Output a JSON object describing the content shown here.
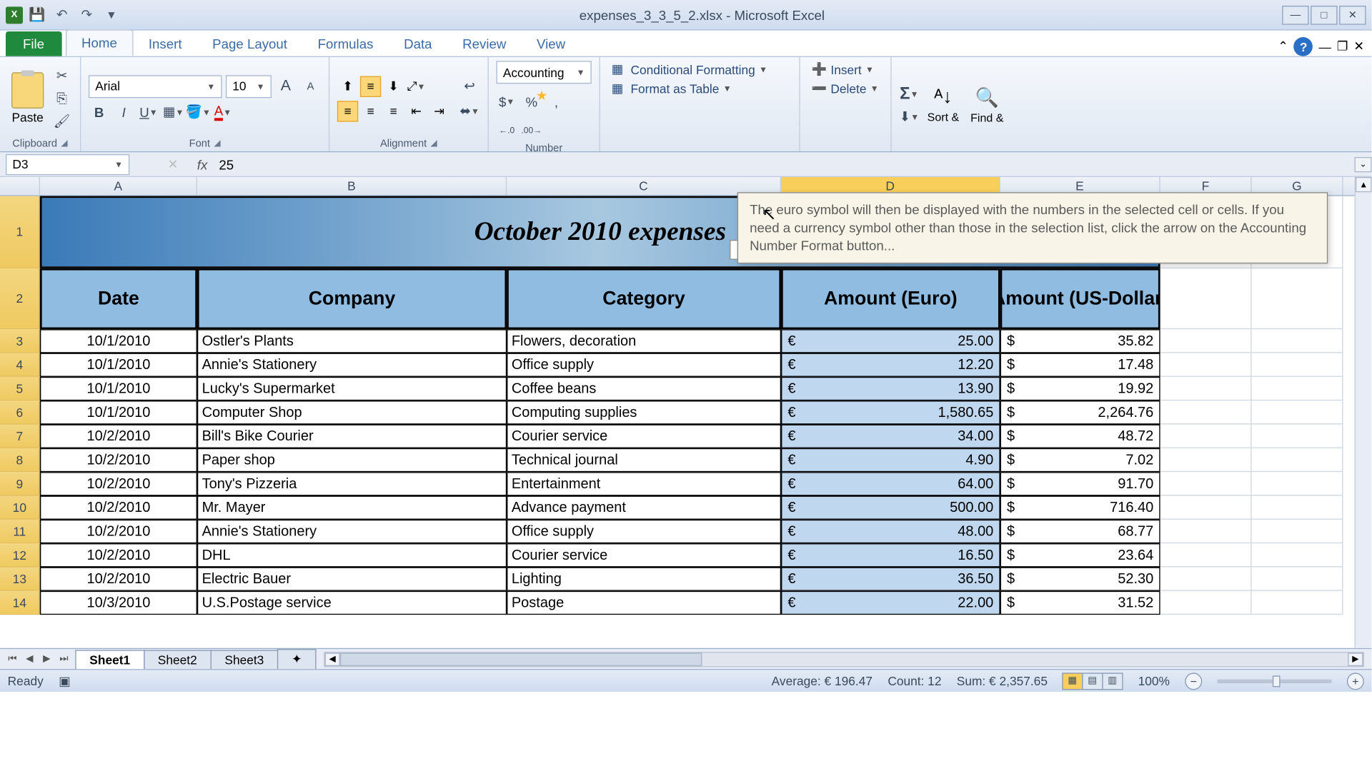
{
  "titlebar": {
    "filename": "expenses_3_3_5_2.xlsx - Microsoft Excel"
  },
  "tabs": {
    "file": "File",
    "home": "Home",
    "insert": "Insert",
    "page_layout": "Page Layout",
    "formulas": "Formulas",
    "data": "Data",
    "review": "Review",
    "view": "View"
  },
  "ribbon": {
    "clipboard": {
      "paste": "Paste",
      "label": "Clipboard"
    },
    "font": {
      "name": "Arial",
      "size": "10",
      "label": "Font"
    },
    "alignment": {
      "label": "Alignment"
    },
    "number": {
      "format": "Accounting",
      "label": "Number",
      "dollar": "$",
      "percent": "%",
      "comma": ",",
      "inc": "←.0\n.00",
      "dec": ".00\n→.0"
    },
    "styles": {
      "cond": "Conditional Formatting",
      "table": "Format as Table"
    },
    "cells": {
      "insert": "Insert",
      "delete": "Delete"
    },
    "editing": {
      "sort": "Sort &",
      "find": "Find &"
    }
  },
  "tooltip": "The euro symbol will then be displayed with the numbers in the selected cell or cells. If you need a currency symbol other than those in the selection list, click the arrow on the Accounting Number Format button...",
  "namebox": "D3",
  "formula": "25",
  "formula_bar_label": "Formula Bar",
  "columns": [
    "A",
    "B",
    "C",
    "D",
    "E",
    "F",
    "G"
  ],
  "title_cell": "October 2010 expenses",
  "headers": {
    "date": "Date",
    "company": "Company",
    "category": "Category",
    "euro": "Amount (Euro)",
    "usd": "Amount (US-Dollar)"
  },
  "rows": [
    {
      "n": "3",
      "date": "10/1/2010",
      "company": "Ostler's Plants",
      "category": "Flowers, decoration",
      "euro": "25.00",
      "usd": "35.82"
    },
    {
      "n": "4",
      "date": "10/1/2010",
      "company": "Annie's Stationery",
      "category": "Office supply",
      "euro": "12.20",
      "usd": "17.48"
    },
    {
      "n": "5",
      "date": "10/1/2010",
      "company": "Lucky's Supermarket",
      "category": "Coffee beans",
      "euro": "13.90",
      "usd": "19.92"
    },
    {
      "n": "6",
      "date": "10/1/2010",
      "company": "Computer Shop",
      "category": "Computing supplies",
      "euro": "1,580.65",
      "usd": "2,264.76"
    },
    {
      "n": "7",
      "date": "10/2/2010",
      "company": "Bill's Bike Courier",
      "category": "Courier service",
      "euro": "34.00",
      "usd": "48.72"
    },
    {
      "n": "8",
      "date": "10/2/2010",
      "company": "Paper shop",
      "category": "Technical journal",
      "euro": "4.90",
      "usd": "7.02"
    },
    {
      "n": "9",
      "date": "10/2/2010",
      "company": "Tony's Pizzeria",
      "category": "Entertainment",
      "euro": "64.00",
      "usd": "91.70"
    },
    {
      "n": "10",
      "date": "10/2/2010",
      "company": "Mr. Mayer",
      "category": "Advance payment",
      "euro": "500.00",
      "usd": "716.40"
    },
    {
      "n": "11",
      "date": "10/2/2010",
      "company": "Annie's Stationery",
      "category": "Office supply",
      "euro": "48.00",
      "usd": "68.77"
    },
    {
      "n": "12",
      "date": "10/2/2010",
      "company": "DHL",
      "category": "Courier service",
      "euro": "16.50",
      "usd": "23.64"
    },
    {
      "n": "13",
      "date": "10/2/2010",
      "company": "Electric Bauer",
      "category": "Lighting",
      "euro": "36.50",
      "usd": "52.30"
    },
    {
      "n": "14",
      "date": "10/3/2010",
      "company": "U.S.Postage service",
      "category": "Postage",
      "euro": "22.00",
      "usd": "31.52"
    }
  ],
  "currency": {
    "euro": "€",
    "usd": "$"
  },
  "sheets": [
    "Sheet1",
    "Sheet2",
    "Sheet3"
  ],
  "status": {
    "ready": "Ready",
    "average": "Average:  € 196.47",
    "count": "Count: 12",
    "sum": "Sum:  € 2,357.65",
    "zoom": "100%"
  }
}
